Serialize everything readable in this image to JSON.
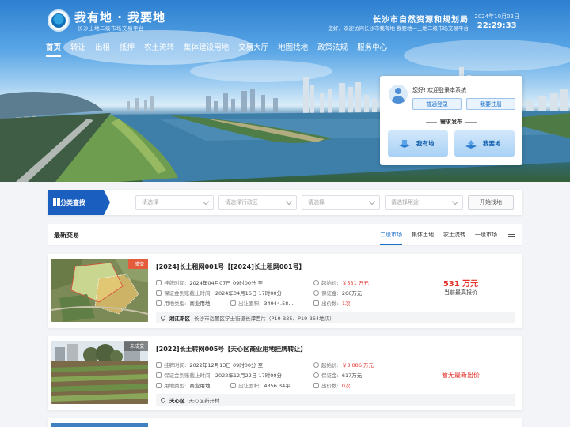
{
  "header": {
    "brand_title": "我有地 · 我要地",
    "brand_sub": "长沙土地二级市场交易平台",
    "bureau": "长沙市自然资源和规划局",
    "welcome": "您好，欢迎访问长沙市我有地·我要地—土地二级市场交易平台",
    "date": "2024年10月02日",
    "time": "22:29:33"
  },
  "nav": [
    "首页",
    "转让",
    "出租",
    "抵押",
    "农土流转",
    "集体建设用地",
    "交易大厅",
    "地图找地",
    "政策法规",
    "服务中心"
  ],
  "login": {
    "hint": "您好! 欢迎登录本系统",
    "login_btn": "普通登录",
    "register_btn": "我要注册",
    "need_title": "需求发布",
    "have_land": "我有地",
    "want_land": "我要地"
  },
  "filter": {
    "tag": "分类查找",
    "placeholders": [
      "请选择",
      "请选择行政区",
      "请选择",
      "请选择用途"
    ],
    "find_btn": "开始找地"
  },
  "latest": {
    "title": "最新交易",
    "tabs": [
      "二级市场",
      "集体土地",
      "农土流转",
      "一级市场"
    ]
  },
  "listings": [
    {
      "badge": "成交",
      "title": "[2024]长土租网001号【[2024]长土租网001号】",
      "listing_time_label": "挂牌时间:",
      "listing_time": "2024年04月07日 09时00分 至",
      "deposit_deadline_label": "保证金到账截止时间:",
      "deposit_deadline": "2024年04月16日 17时00分",
      "land_use_label": "用地类型:",
      "land_use": "商业用地",
      "area_label": "出让面积:",
      "area": "34944.58...",
      "start_price_label": "起始价:",
      "start_price": "￥531 万元",
      "deposit_label": "保证金:",
      "deposit": "266万元",
      "bids_label": "出价数:",
      "bids": "1次",
      "price_big": "531 万元",
      "price_sub": "当前最高报价",
      "district": "湘江新区",
      "address": "长沙市岳麓区学士街道长潭西片（P19-B35、P19-B64地块）"
    },
    {
      "badge": "未成交",
      "title": "[2022]长土转网005号【天心区商业用地挂牌转让】",
      "listing_time_label": "挂牌时间:",
      "listing_time": "2022年12月13日 09时00分 至",
      "deposit_deadline_label": "保证金到账截止时间:",
      "deposit_deadline": "2022年12月22日 17时00分",
      "land_use_label": "用地类型:",
      "land_use": "商业用地",
      "area_label": "出让面积:",
      "area": "4356.34平...",
      "start_price_label": "起始价:",
      "start_price": "￥3,086 万元",
      "deposit_label": "保证金:",
      "deposit": "617万元",
      "bids_label": "出价数:",
      "bids": "0次",
      "price_none": "暂无最新出价",
      "district": "天心区",
      "address": "天心区新开村"
    }
  ],
  "colors": {
    "primary": "#1a5fbf",
    "accent_red": "#e2312b",
    "link_blue": "#1a6fc7"
  }
}
